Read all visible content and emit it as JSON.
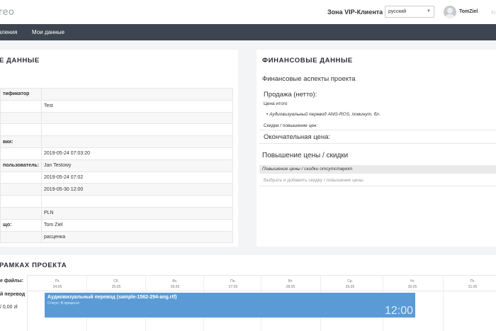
{
  "header": {
    "logo_text": "reo",
    "vip_zone": "Зона VIP-Клиента",
    "language": "русский",
    "username": "TomZiel",
    "trail": "in"
  },
  "nav": {
    "items": [
      "вления",
      "Мои данные"
    ]
  },
  "left_panel": {
    "title": "Е ДАННЫЕ",
    "rows": [
      {
        "key": "тификатор",
        "value": ""
      },
      {
        "key": "",
        "value": "Test"
      },
      {
        "key": "",
        "value": ""
      },
      {
        "key": "",
        "value": ""
      },
      {
        "key": "вки:",
        "value": ""
      },
      {
        "key": "",
        "value": "2019-05-24 07:03:20"
      },
      {
        "key": "пользователь:",
        "value": "Jan Testowy"
      },
      {
        "key": "",
        "value": "2019-05-24 07:02"
      },
      {
        "key": "",
        "value": "2019-05-30 12:00"
      },
      {
        "key": "",
        "value": ""
      },
      {
        "key": "",
        "value": "PLN"
      },
      {
        "key": "що:",
        "value": "Tom Ziel"
      },
      {
        "key": "",
        "value": "расценка"
      }
    ]
  },
  "finance": {
    "title": "ФИНАНСОВЫЕ ДАННЫЕ",
    "subtitle": "Финансовые аспекты проекта",
    "sale_label": "Продажа (нетто):",
    "price_total": "Цена итого",
    "item": "• Аудиовизуальный перевод ANG-ROS, поминут. бл.",
    "discounts_label": "Скидки / повышение цен:",
    "final_price": "Окончательная цена:",
    "section2_title": "Повышение цены / скидки",
    "none_text": "Повышение цены / скидки отсутствуют",
    "add_placeholder": "Выбрать и добавить скидку / повышение цены"
  },
  "timeline": {
    "title": "РАМКАХ ПРОЕКТА",
    "files_label": "е файлы:",
    "row_label": "й перевод",
    "row_value": "/ 0,00 zł",
    "days": [
      {
        "name": "Пт.",
        "date": "24.05"
      },
      {
        "name": "Сб.",
        "date": "25.05"
      },
      {
        "name": "Вс.",
        "date": "26.05"
      },
      {
        "name": "Пн.",
        "date": "27.05"
      },
      {
        "name": "Вт.",
        "date": "28.05"
      },
      {
        "name": "Ср.",
        "date": "29.05"
      },
      {
        "name": "Чт.",
        "date": "30.05"
      },
      {
        "name": "Пт.",
        "date": "31.05"
      }
    ],
    "task": {
      "title": "Аудиовизуальный перевод (sample-1562-294-ang.rtf)",
      "status": "Статус: В процессе",
      "time": "12:00"
    }
  },
  "colors": {
    "nav_bg": "#3c4550",
    "task_bar": "#5b9bd5",
    "page_bg": "#f3f4f6"
  }
}
